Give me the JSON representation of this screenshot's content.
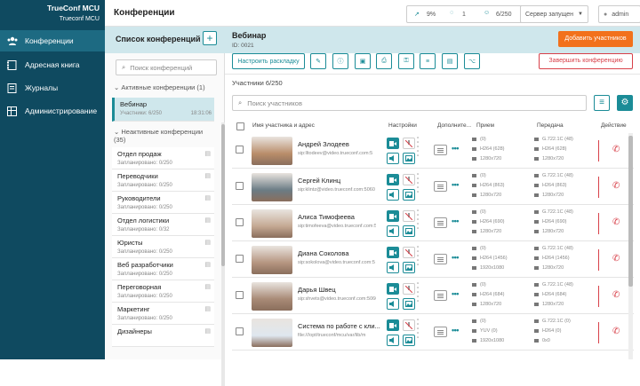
{
  "app": {
    "brand": "TrueConf MCU",
    "subbrand": "Trueconf MCU"
  },
  "nav": [
    {
      "label": "Конференции"
    },
    {
      "label": "Адресная книга"
    },
    {
      "label": "Журналы"
    },
    {
      "label": "Администрирование"
    }
  ],
  "header": {
    "title": "Конференции",
    "cpu": "9%",
    "users": "1",
    "participants": "6/250",
    "server_status": "Сервер запущен",
    "user": "admin"
  },
  "conf_list": {
    "title": "Список конференций",
    "search_placeholder": "Поиск конференций",
    "active_group": "Активные конференции (1)",
    "inactive_group": "Неактивные конференции (35)",
    "active": [
      {
        "name": "Вебинар",
        "status": "Участники: 6/250",
        "time": "18:31:06"
      }
    ],
    "inactive": [
      {
        "name": "Отдел продаж",
        "status": "Запланировано: 0/250"
      },
      {
        "name": "Переводчики",
        "status": "Запланировано: 0/250"
      },
      {
        "name": "Руководители",
        "status": "Запланировано: 0/250"
      },
      {
        "name": "Отдел логистики",
        "status": "Запланировано: 0/32"
      },
      {
        "name": "Юристы",
        "status": "Запланировано: 0/250"
      },
      {
        "name": "Веб разработчики",
        "status": "Запланировано: 0/250"
      },
      {
        "name": "Переговорная",
        "status": "Запланировано: 0/250"
      },
      {
        "name": "Маркетинг",
        "status": "Запланировано: 0/250"
      },
      {
        "name": "Дизайнеры",
        "status": ""
      }
    ]
  },
  "conference": {
    "title": "Вебинар",
    "id": "ID: 0021",
    "add_button": "Добавить участников",
    "layout_button": "Настроить раскладку",
    "end_button": "Завершить конференцию",
    "participants_count": "Участники 6/250",
    "search_placeholder": "Поиск участников"
  },
  "columns": {
    "name": "Имя участника и адрес",
    "settings": "Настройки",
    "extra": "Дополните...",
    "receive": "Прием",
    "send": "Передача",
    "action": "Действие"
  },
  "participants": [
    {
      "name": "Андрей Злодеев",
      "address": "sip:lltodeev@video.trueconf.com:5",
      "rx": [
        "(0)",
        "H264 (628)",
        "1280x720"
      ],
      "tx": [
        "G.722.1C (48)",
        "H264 (628)",
        "1280x720"
      ],
      "avatar": "#b98d6a"
    },
    {
      "name": "Сергей Клинц",
      "address": "sip:klintz@video.trueconf.com:5060",
      "rx": [
        "(0)",
        "H264 (863)",
        "1280x720"
      ],
      "tx": [
        "G.722.1C (48)",
        "H264 (863)",
        "1280x720"
      ],
      "avatar": "#6b7c85"
    },
    {
      "name": "Алиса Тимофеева",
      "address": "sip:timofeeva@video.trueconf.com:5",
      "rx": [
        "(0)",
        "H264 (690)",
        "1280x720"
      ],
      "tx": [
        "G.722.1C (48)",
        "H264 (690)",
        "1280x720"
      ],
      "avatar": "#c4a892"
    },
    {
      "name": "Диана Соколова",
      "address": "sip:sokolova@video.trueconf.com:5",
      "rx": [
        "(0)",
        "H264 (1456)",
        "1920x1080"
      ],
      "tx": [
        "G.722.1C (48)",
        "H264 (1456)",
        "1280x720"
      ],
      "avatar": "#b59580"
    },
    {
      "name": "Дарья Швец",
      "address": "sip:shvets@video.trueconf.com:5060",
      "rx": [
        "(0)",
        "H264 (684)",
        "1280x720"
      ],
      "tx": [
        "G.722.1C (48)",
        "H264 (684)",
        "1280x720"
      ],
      "avatar": "#a88a76"
    },
    {
      "name": "Система по работе с кли...",
      "address": "file:///opt/trueconf/mcu/var/lib/m",
      "rx": [
        "(0)",
        "YUV (0)",
        "1920x1080"
      ],
      "tx": [
        "G.722.1C (0)",
        "H264 (0)",
        "0x0"
      ],
      "avatar": "#dfe7ef"
    }
  ]
}
